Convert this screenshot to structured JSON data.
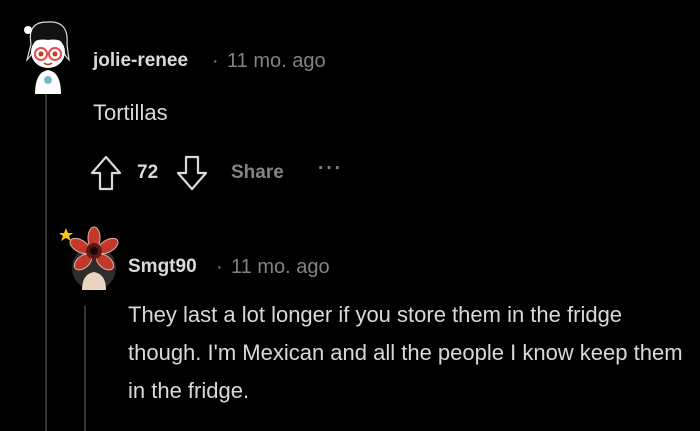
{
  "comments": [
    {
      "username": "jolie-renee",
      "separator": "·",
      "timestamp": "11 mo. ago",
      "body": "Tortillas",
      "score": "72",
      "share_label": "Share",
      "more_label": "···",
      "avatar_icon": "anime-girl-avatar-icon"
    },
    {
      "username": "Smgt90",
      "separator": "·",
      "timestamp": "11 mo. ago",
      "body": "They last a lot longer if you store them in the fridge though. I'm Mexican and all the people I know keep them in the fridge.",
      "avatar_icon": "flower-monster-avatar-icon"
    }
  ],
  "colors": {
    "background": "#000000",
    "text": "#d7dadc",
    "meta": "#818384",
    "thread_line": "#343536"
  }
}
